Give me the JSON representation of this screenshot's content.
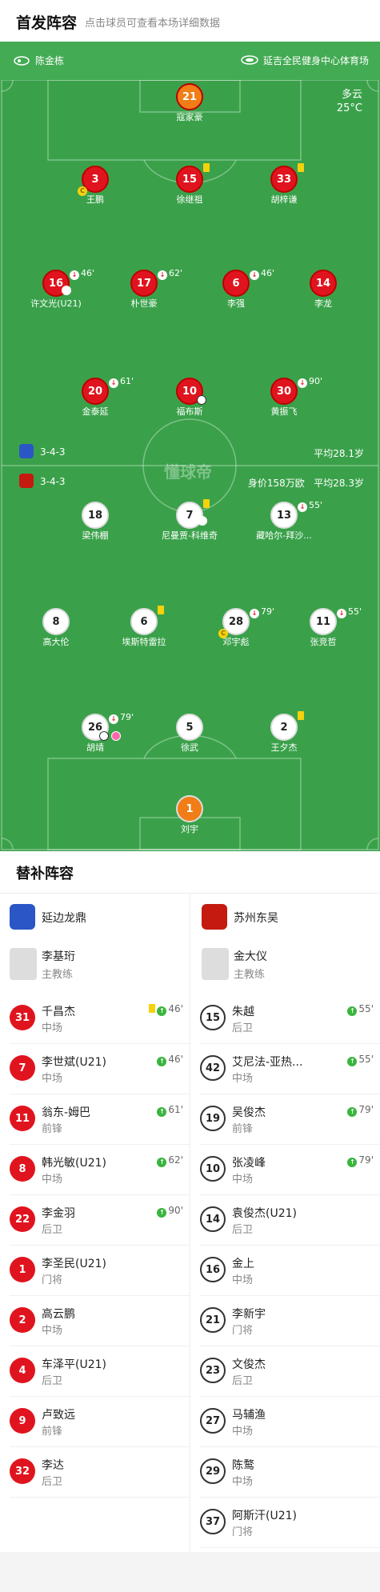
{
  "header": {
    "title": "首发阵容",
    "subtitle": "点击球员可查看本场详细数据"
  },
  "pitch_info": {
    "referee": "陈金栋",
    "venue": "延吉全民健身中心体育场",
    "weather": "多云",
    "temp": "25°C",
    "watermark": "懂球帝"
  },
  "home_bar": {
    "formation": "3-4-3",
    "avg_age": "平均28.1岁"
  },
  "away_bar": {
    "formation": "3-4-3",
    "value": "身价158万欧",
    "avg_age": "平均28.3岁"
  },
  "home_players": [
    {
      "num": "21",
      "name": "寇家豪"
    },
    {
      "num": "3",
      "name": "王鹏"
    },
    {
      "num": "15",
      "name": "徐继祖"
    },
    {
      "num": "33",
      "name": "胡梓谦"
    },
    {
      "num": "16",
      "name": "许文光(U21)",
      "sub": "46'"
    },
    {
      "num": "17",
      "name": "朴世豪",
      "sub": "62'"
    },
    {
      "num": "6",
      "name": "李强",
      "sub": "46'"
    },
    {
      "num": "14",
      "name": "李龙"
    },
    {
      "num": "20",
      "name": "金泰延",
      "sub": "61'"
    },
    {
      "num": "10",
      "name": "福布斯"
    },
    {
      "num": "30",
      "name": "黄振飞",
      "sub": "90'"
    }
  ],
  "away_players": [
    {
      "num": "18",
      "name": "梁伟棚"
    },
    {
      "num": "7",
      "name": "尼曼贾-科维奇"
    },
    {
      "num": "13",
      "name": "藏哈尔-拜沙...",
      "sub": "55'"
    },
    {
      "num": "8",
      "name": "高大伦"
    },
    {
      "num": "6",
      "name": "埃斯特雷拉"
    },
    {
      "num": "28",
      "name": "邓宇彪",
      "sub": "79'"
    },
    {
      "num": "11",
      "name": "张竞哲",
      "sub": "55'"
    },
    {
      "num": "26",
      "name": "胡靖",
      "sub": "79'"
    },
    {
      "num": "5",
      "name": "徐武"
    },
    {
      "num": "2",
      "name": "王夕杰"
    },
    {
      "num": "1",
      "name": "刘宇"
    }
  ],
  "subs": {
    "title": "替补阵容",
    "home_team": "延边龙鼎",
    "away_team": "苏州东吴",
    "home_coach": {
      "name": "李基珩",
      "role": "主教练"
    },
    "away_coach": {
      "name": "金大仪",
      "role": "主教练"
    },
    "home": [
      {
        "num": "31",
        "name": "千昌杰",
        "pos": "中场",
        "ev": "46'"
      },
      {
        "num": "7",
        "name": "李世斌(U21)",
        "pos": "中场",
        "ev": "46'"
      },
      {
        "num": "11",
        "name": "翁东-姆巴",
        "pos": "前锋",
        "ev": "61'"
      },
      {
        "num": "8",
        "name": "韩光敏(U21)",
        "pos": "中场",
        "ev": "62'"
      },
      {
        "num": "22",
        "name": "李金羽",
        "pos": "后卫",
        "ev": "90'"
      },
      {
        "num": "1",
        "name": "李圣民(U21)",
        "pos": "门将"
      },
      {
        "num": "2",
        "name": "高云鹏",
        "pos": "中场"
      },
      {
        "num": "4",
        "name": "车泽平(U21)",
        "pos": "后卫"
      },
      {
        "num": "9",
        "name": "卢致远",
        "pos": "前锋"
      },
      {
        "num": "32",
        "name": "李达",
        "pos": "后卫"
      }
    ],
    "away": [
      {
        "num": "15",
        "name": "朱越",
        "pos": "后卫",
        "ev": "55'"
      },
      {
        "num": "42",
        "name": "艾尼法-亚热...",
        "pos": "中场",
        "ev": "55'"
      },
      {
        "num": "19",
        "name": "吴俊杰",
        "pos": "前锋",
        "ev": "79'"
      },
      {
        "num": "10",
        "name": "张凌峰",
        "pos": "中场",
        "ev": "79'"
      },
      {
        "num": "14",
        "name": "袁俊杰(U21)",
        "pos": "后卫"
      },
      {
        "num": "16",
        "name": "金上",
        "pos": "中场"
      },
      {
        "num": "21",
        "name": "李新宇",
        "pos": "门将"
      },
      {
        "num": "23",
        "name": "文俊杰",
        "pos": "后卫"
      },
      {
        "num": "27",
        "name": "马辅渔",
        "pos": "中场"
      },
      {
        "num": "29",
        "name": "陈鹜",
        "pos": "中场"
      },
      {
        "num": "37",
        "name": "阿斯汗(U21)",
        "pos": "门将"
      }
    ]
  },
  "colors": {
    "pitch": "#3aa14a",
    "home": "#e0141e",
    "gk": "#f07d16",
    "yellow": "#f5d20c",
    "sub_green": "#3ab53e"
  }
}
